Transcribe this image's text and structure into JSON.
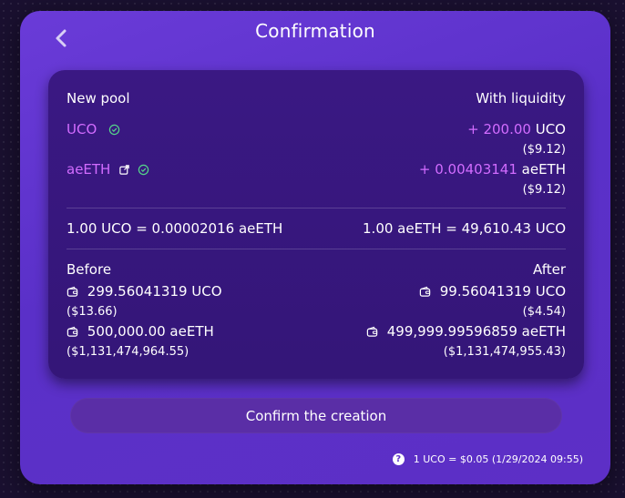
{
  "header": {
    "title": "Confirmation"
  },
  "summary": {
    "left_title": "New pool",
    "right_title": "With liquidity",
    "token1": {
      "symbol": "UCO",
      "amount": "+ 200.00",
      "unit": "UCO",
      "usd": "($9.12)"
    },
    "token2": {
      "symbol": "aeETH",
      "amount": "+ 0.00403141",
      "unit": "aeETH",
      "usd": "($9.12)"
    },
    "rate_left": "1.00 UCO = 0.00002016 aeETH",
    "rate_right": "1.00 aeETH = 49,610.43 UCO",
    "before_label": "Before",
    "after_label": "After",
    "before": [
      {
        "amount": "299.56041319 UCO",
        "usd": "($13.66)"
      },
      {
        "amount": "500,000.00 aeETH",
        "usd": "($1,131,474,964.55)"
      }
    ],
    "after": [
      {
        "amount": "99.56041319 UCO",
        "usd": "($4.54)"
      },
      {
        "amount": "499,999.99596859 aeETH",
        "usd": "($1,131,474,955.43)"
      }
    ]
  },
  "actions": {
    "confirm_label": "Confirm the creation"
  },
  "footer": {
    "help_glyph": "?",
    "price_text": "1 UCO = $0.05 (1/29/2024 09:55)"
  },
  "colors": {
    "accent": "#d26cff",
    "verified": "#55d68a"
  }
}
